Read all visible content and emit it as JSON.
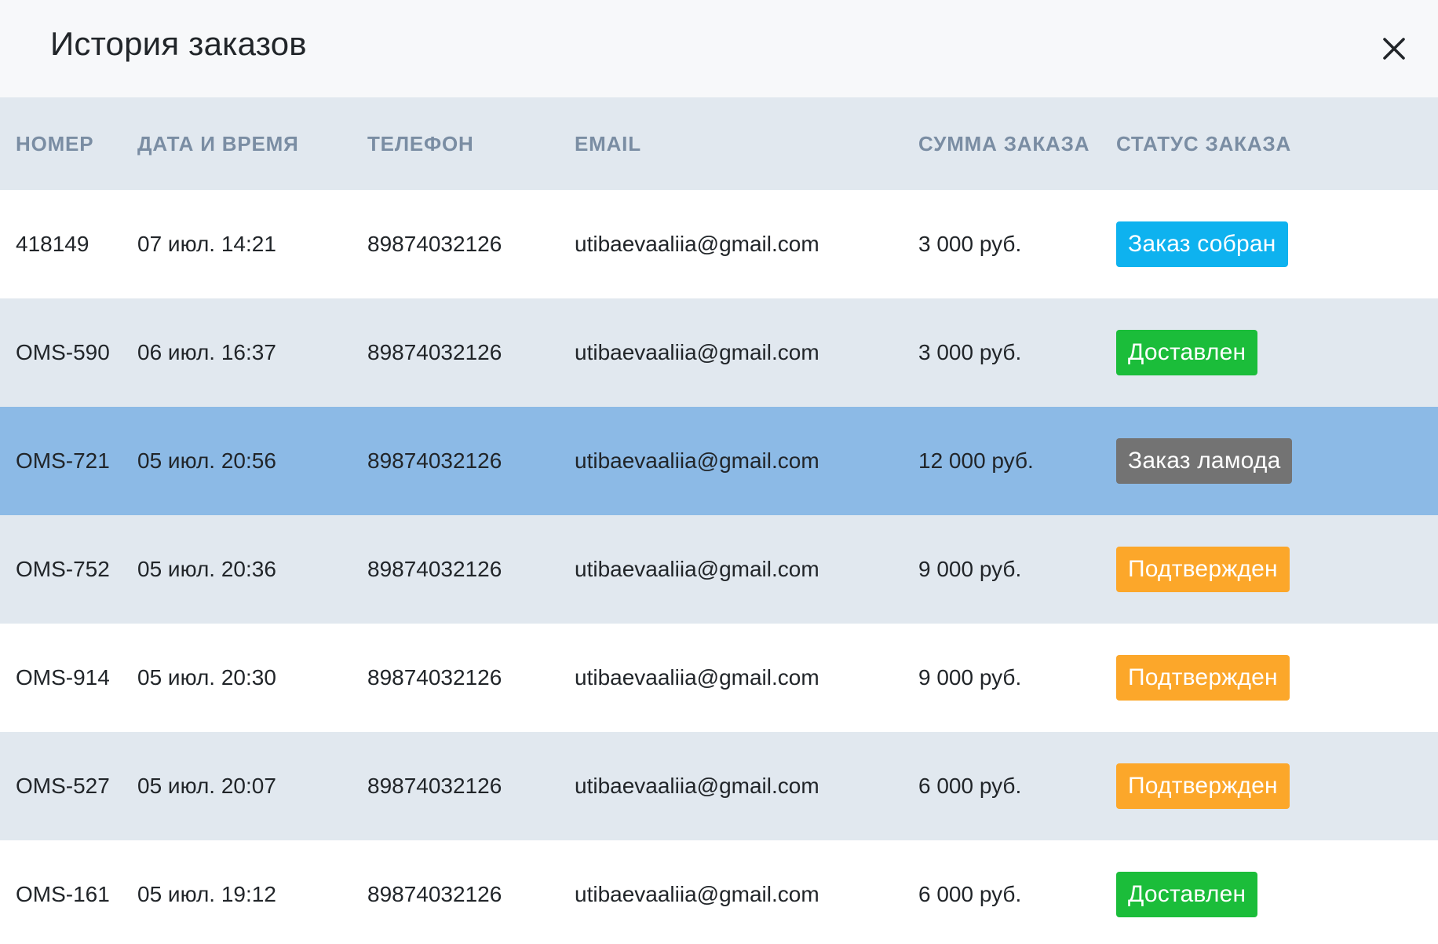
{
  "header": {
    "title": "История заказов",
    "close_icon": "close-icon"
  },
  "table": {
    "columns": [
      "НОМЕР",
      "ДАТА И ВРЕМЯ",
      "ТЕЛЕФОН",
      "EMAIL",
      "СУММА ЗАКАЗА",
      "СТАТУС ЗАКАЗА"
    ],
    "rows": [
      {
        "number": "418149",
        "datetime": "07 июл. 14:21",
        "phone": "89874032126",
        "email": "utibaevaaliia@gmail.com",
        "sum": "3 000 руб.",
        "status": "Заказ собран",
        "status_color": "#0eb2ef",
        "row_style": "white"
      },
      {
        "number": "OMS-590",
        "datetime": "06 июл. 16:37",
        "phone": "89874032126",
        "email": "utibaevaaliia@gmail.com",
        "sum": "3 000 руб.",
        "status": "Доставлен",
        "status_color": "#1bbd3a",
        "row_style": "gray"
      },
      {
        "number": "OMS-721",
        "datetime": "05 июл. 20:56",
        "phone": "89874032126",
        "email": "utibaevaaliia@gmail.com",
        "sum": "12 000 руб.",
        "status": "Заказ ламода",
        "status_color": "#737373",
        "row_style": "selected"
      },
      {
        "number": "OMS-752",
        "datetime": "05 июл. 20:36",
        "phone": "89874032126",
        "email": "utibaevaaliia@gmail.com",
        "sum": "9 000 руб.",
        "status": "Подтвержден",
        "status_color": "#fca72a",
        "row_style": "gray"
      },
      {
        "number": "OMS-914",
        "datetime": "05 июл. 20:30",
        "phone": "89874032126",
        "email": "utibaevaaliia@gmail.com",
        "sum": "9 000 руб.",
        "status": "Подтвержден",
        "status_color": "#fca72a",
        "row_style": "white"
      },
      {
        "number": "OMS-527",
        "datetime": "05 июл. 20:07",
        "phone": "89874032126",
        "email": "utibaevaaliia@gmail.com",
        "sum": "6 000 руб.",
        "status": "Подтвержден",
        "status_color": "#fca72a",
        "row_style": "gray"
      },
      {
        "number": "OMS-161",
        "datetime": "05 июл. 19:12",
        "phone": "89874032126",
        "email": "utibaevaaliia@gmail.com",
        "sum": "6 000 руб.",
        "status": "Доставлен",
        "status_color": "#1bbd3a",
        "row_style": "white"
      }
    ]
  }
}
